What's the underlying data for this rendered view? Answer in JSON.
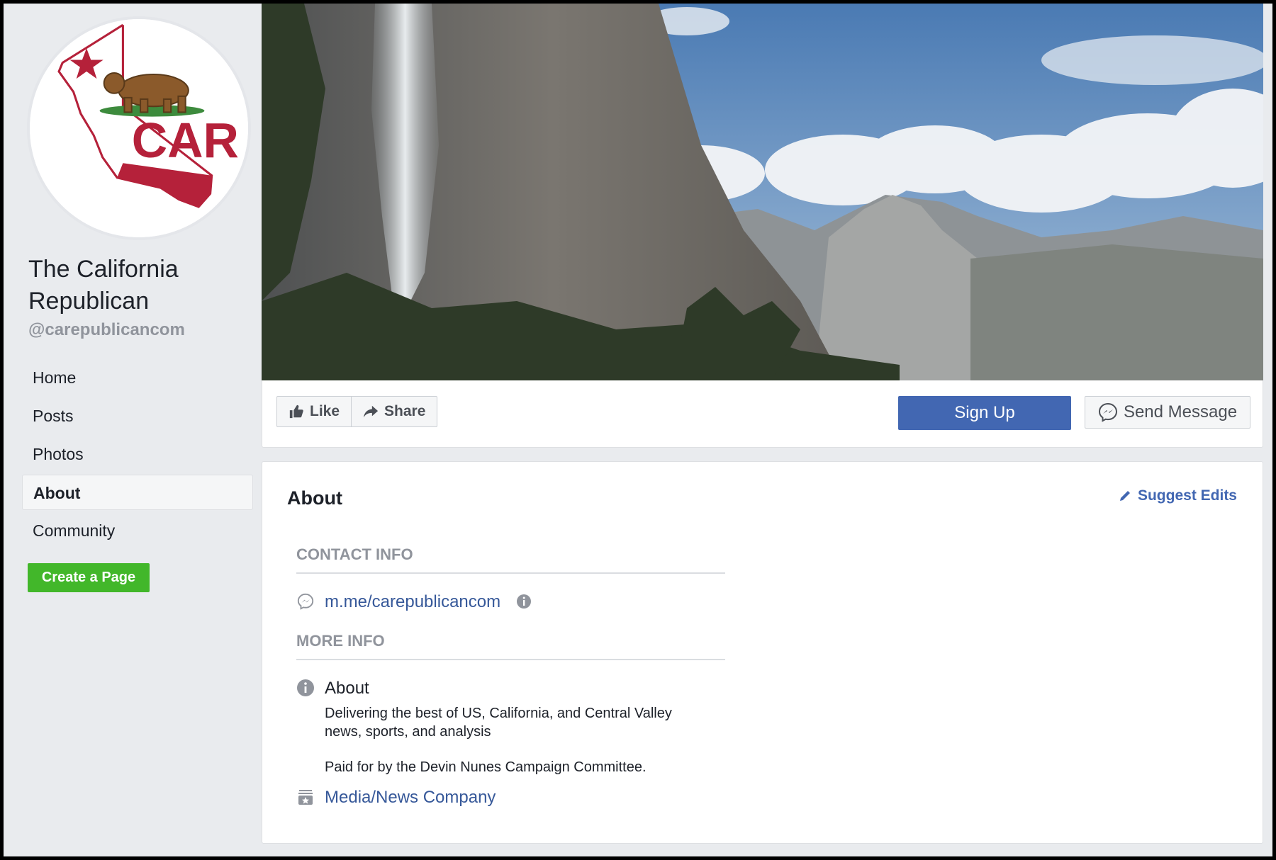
{
  "page": {
    "name": "The California Republican",
    "handle": "@carepublicancom",
    "logo_text": "CAR"
  },
  "sidebar": {
    "items": [
      {
        "label": "Home",
        "active": false
      },
      {
        "label": "Posts",
        "active": false
      },
      {
        "label": "Photos",
        "active": false
      },
      {
        "label": "About",
        "active": true
      },
      {
        "label": "Community",
        "active": false
      }
    ],
    "create_page_label": "Create a Page"
  },
  "actions": {
    "like_label": "Like",
    "share_label": "Share",
    "signup_label": "Sign Up",
    "send_message_label": "Send Message"
  },
  "about": {
    "title": "About",
    "suggest_edits_label": "Suggest Edits",
    "contact_info_heading": "CONTACT INFO",
    "messenger_link": "m.me/carepublicancom",
    "more_info_heading": "MORE INFO",
    "about_label": "About",
    "description": "Delivering the best of US, California, and Central Valley news, sports, and analysis",
    "disclaimer": "Paid for by the Devin Nunes Campaign Committee.",
    "category": "Media/News Company"
  },
  "colors": {
    "brand_blue": "#4267b2",
    "link_blue": "#365899",
    "create_green": "#42b72a",
    "logo_red": "#b5213a",
    "background": "#e9ebee"
  },
  "icons": [
    "like-icon",
    "share-icon",
    "messenger-icon",
    "pencil-icon",
    "info-icon",
    "category-icon"
  ]
}
